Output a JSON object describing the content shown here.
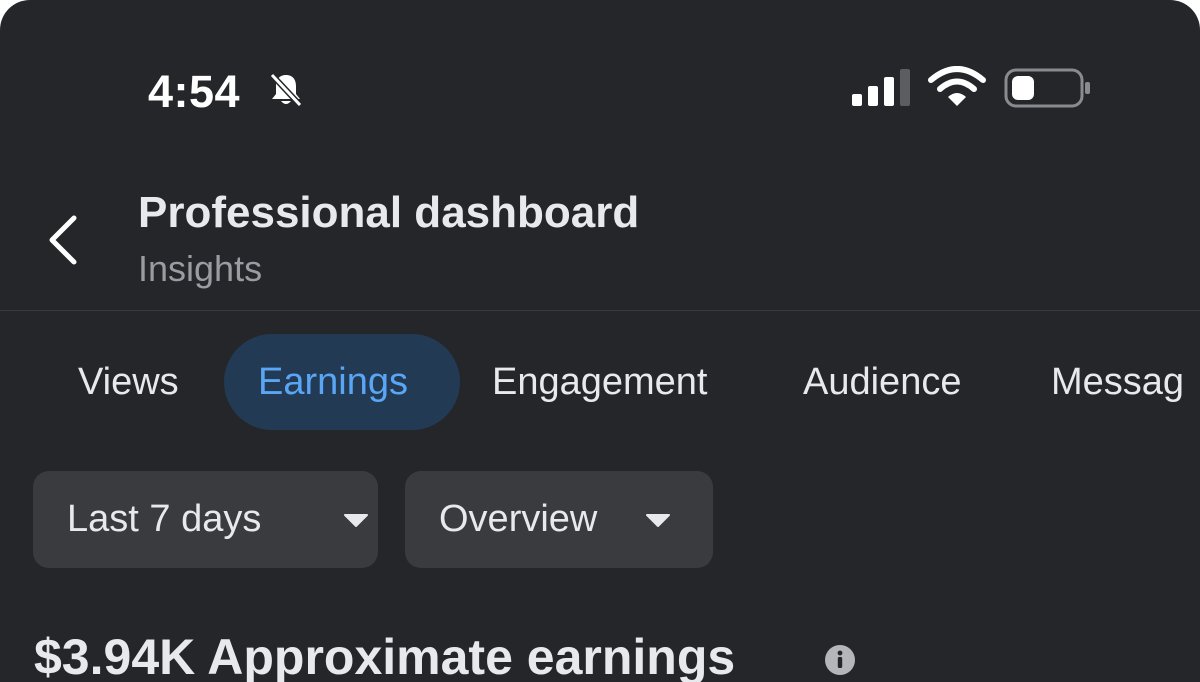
{
  "status_bar": {
    "time": "4:54",
    "icons": [
      "bell-slash-icon",
      "signal-icon",
      "wifi-icon",
      "battery-icon"
    ]
  },
  "header": {
    "title": "Professional dashboard",
    "subtitle": "Insights"
  },
  "tabs": [
    {
      "label": "Views",
      "active": false
    },
    {
      "label": "Earnings",
      "active": true
    },
    {
      "label": "Engagement",
      "active": false
    },
    {
      "label": "Audience",
      "active": false
    },
    {
      "label": "Messag",
      "active": false
    }
  ],
  "filters": {
    "date_range": "Last 7 days",
    "view": "Overview"
  },
  "summary": {
    "earnings_headline": "$3.94K Approximate earnings"
  },
  "colors": {
    "background": "#252629",
    "accent": "#5aa6f5",
    "active_tab_bg": "#233a55",
    "button_bg": "#3a3b3e",
    "text": "#e8e9ec",
    "muted_text": "#9a9ca1"
  }
}
